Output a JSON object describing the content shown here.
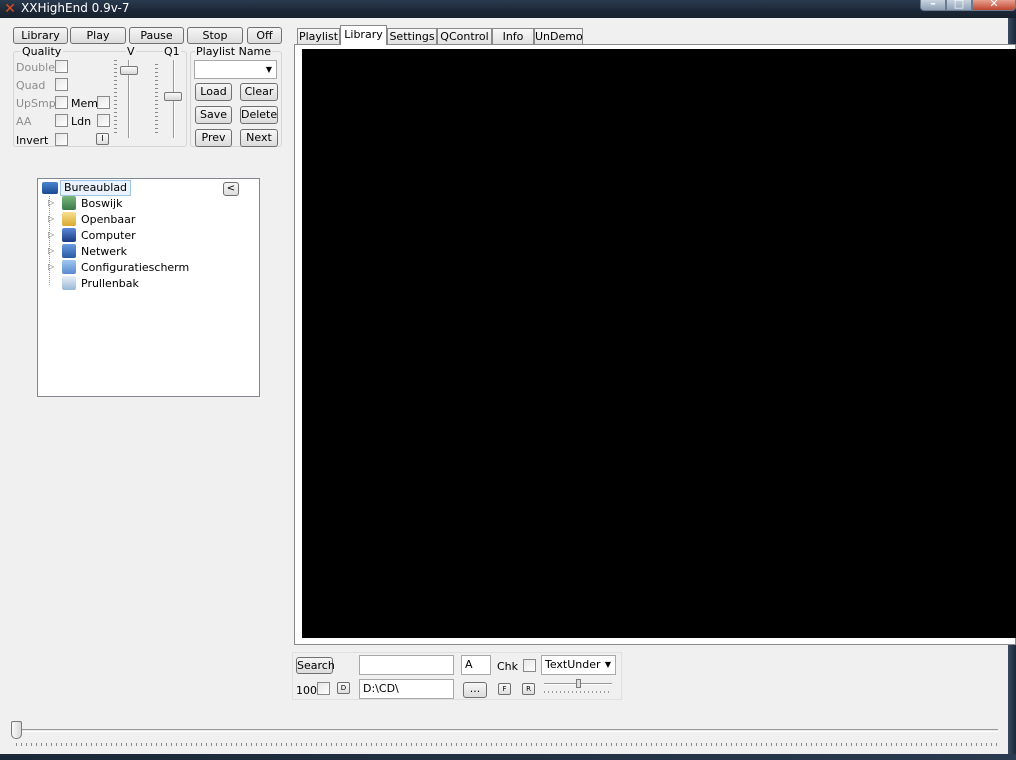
{
  "window": {
    "title": "XXHighEnd 0.9v-7",
    "icon": "xx-logo-icon"
  },
  "toolbar": {
    "library": "Library",
    "play": "Play",
    "pause": "Pause",
    "stop": "Stop",
    "off": "Off"
  },
  "quality": {
    "group_label": "Quality",
    "double": "Double",
    "quad": "Quad",
    "upsmp": "UpSmp",
    "mem": "Mem",
    "aa": "AA",
    "ldn": "Ldn",
    "invert": "Invert",
    "i_button": "I",
    "v_label": "V",
    "q1_label": "Q1"
  },
  "playlist": {
    "name_label": "Playlist Name",
    "name_value": "",
    "load": "Load",
    "clear": "Clear",
    "save": "Save",
    "delete": "Delete",
    "prev": "Prev",
    "next": "Next"
  },
  "tree": {
    "collapse_button": "<",
    "root": "Bureaublad",
    "items": [
      {
        "label": "Boswijk",
        "icon": "user-folder-icon",
        "expandable": true
      },
      {
        "label": "Openbaar",
        "icon": "folder-icon",
        "expandable": true
      },
      {
        "label": "Computer",
        "icon": "computer-icon",
        "expandable": true
      },
      {
        "label": "Netwerk",
        "icon": "network-icon",
        "expandable": true
      },
      {
        "label": "Configuratiescherm",
        "icon": "control-panel-icon",
        "expandable": true
      },
      {
        "label": "Prullenbak",
        "icon": "recycle-bin-icon",
        "expandable": false
      }
    ]
  },
  "tabs": [
    {
      "label": "Playlist",
      "active": false
    },
    {
      "label": "Library",
      "active": true
    },
    {
      "label": "Settings",
      "active": false
    },
    {
      "label": "QControl",
      "active": false
    },
    {
      "label": "Info",
      "active": false
    },
    {
      "label": "UnDemo",
      "active": false
    }
  ],
  "search": {
    "button": "Search",
    "query": "",
    "letter": "A",
    "chk_label": "Chk",
    "view_mode": "TextUnder",
    "count": "100",
    "d_button": "D",
    "path": "D:\\CD\\",
    "browse": "...",
    "f_button": "F",
    "r_button": "R"
  },
  "colors": {
    "video_background": "#000000",
    "title_bar": "#1c2838",
    "window_background": "#f0f0f0"
  }
}
